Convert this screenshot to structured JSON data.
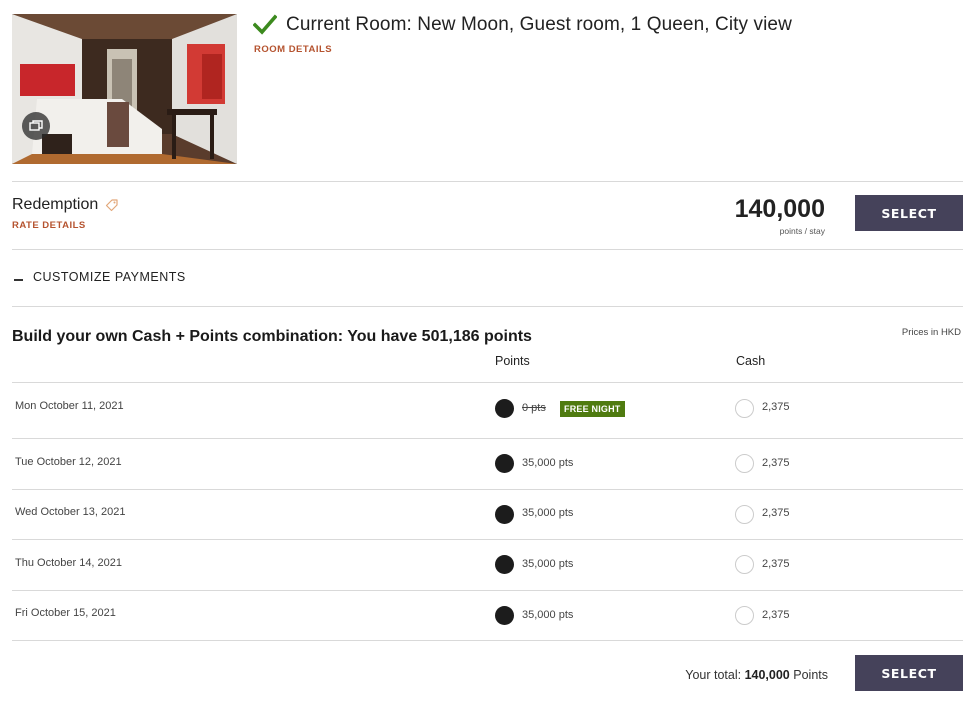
{
  "room": {
    "title": "Current Room: New Moon, Guest room, 1 Queen, City view",
    "details_link": "ROOM DETAILS",
    "photo_icon": "gallery-icon"
  },
  "rate": {
    "name": "Redemption",
    "details_link": "RATE DETAILS",
    "points": "140,000",
    "points_unit": "points / stay",
    "select_label": "SELECT"
  },
  "customize": {
    "label": "CUSTOMIZE PAYMENTS"
  },
  "builder": {
    "title": "Build your own Cash + Points combination: You have 501,186 points",
    "prices_note": "Prices in HKD",
    "col_points": "Points",
    "col_cash": "Cash",
    "nights": [
      {
        "date": "Mon October 11, 2021",
        "points": "0 pts",
        "struck": true,
        "badge": "FREE NIGHT",
        "cash": "2,375",
        "selected": "points"
      },
      {
        "date": "Tue October 12, 2021",
        "points": "35,000 pts",
        "struck": false,
        "badge": "",
        "cash": "2,375",
        "selected": "points"
      },
      {
        "date": "Wed October 13, 2021",
        "points": "35,000 pts",
        "struck": false,
        "badge": "",
        "cash": "2,375",
        "selected": "points"
      },
      {
        "date": "Thu October 14, 2021",
        "points": "35,000 pts",
        "struck": false,
        "badge": "",
        "cash": "2,375",
        "selected": "points"
      },
      {
        "date": "Fri October 15, 2021",
        "points": "35,000 pts",
        "struck": false,
        "badge": "",
        "cash": "2,375",
        "selected": "points"
      }
    ]
  },
  "total": {
    "label": "Your total:",
    "value": "140,000",
    "unit": "Points",
    "select_label": "SELECT"
  },
  "colors": {
    "accent": "#b5532f",
    "button": "#45425a",
    "check": "#3c8a1e",
    "badge": "#4f7b10"
  }
}
